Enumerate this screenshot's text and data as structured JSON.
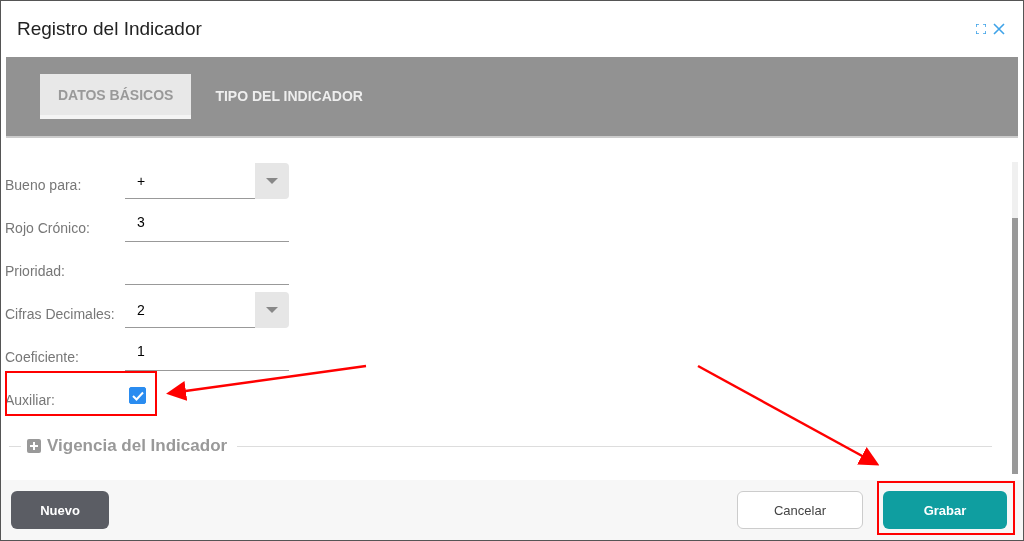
{
  "window": {
    "title": "Registro del Indicador"
  },
  "tabs": [
    {
      "label": "DATOS BÁSICOS",
      "selected": true
    },
    {
      "label": "TIPO DEL INDICADOR",
      "selected": false
    }
  ],
  "fields": [
    {
      "kind": "select",
      "label": "Bueno para:",
      "value": "+"
    },
    {
      "kind": "text",
      "label": "Rojo Crónico:",
      "value": "3"
    },
    {
      "kind": "text",
      "label": "Prioridad:"
    },
    {
      "kind": "select",
      "label": "Cifras Decimales:",
      "value": "2"
    },
    {
      "kind": "text",
      "label": "Coeficiente:",
      "value": "1"
    },
    {
      "kind": "checkbox",
      "label": "Auxiliar:",
      "checked": true
    }
  ],
  "section": {
    "title": "Vigencia del Indicador",
    "expanded": false
  },
  "buttons": [
    {
      "label": "Nuevo",
      "kind": "dark"
    },
    {
      "label": "Cancelar",
      "kind": "outline"
    },
    {
      "label": "Grabar",
      "kind": "primary"
    }
  ]
}
